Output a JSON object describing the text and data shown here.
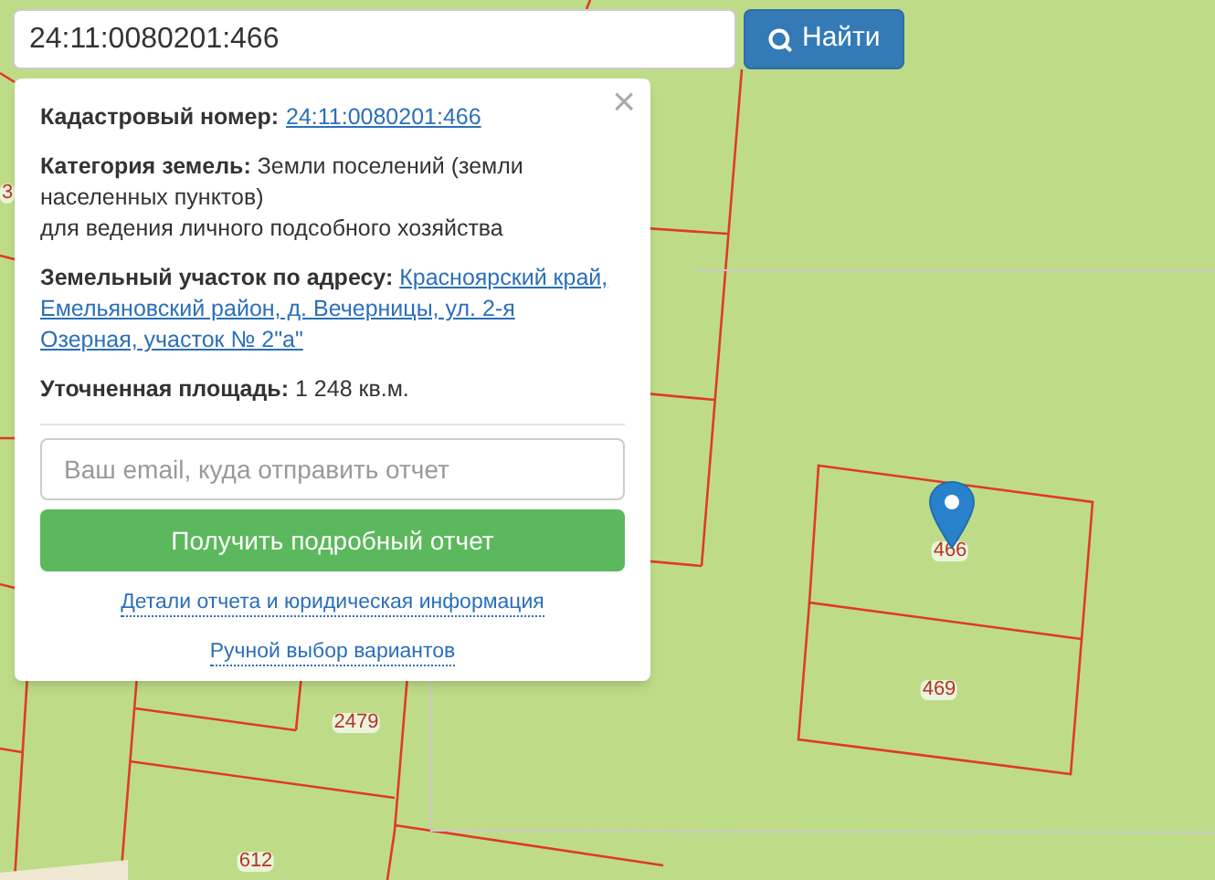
{
  "search": {
    "value": "24:11:0080201:466",
    "button": "Найти"
  },
  "popup": {
    "close": "×",
    "fields": [
      {
        "kind": "link",
        "label": "Кадастровый номер:",
        "value": "24:11:0080201:466"
      },
      {
        "kind": "text",
        "label": "Категория земель:",
        "value": "Земли поселений (земли населенных пунктов)",
        "note": "для ведения личного подсобного хозяйства"
      },
      {
        "kind": "address",
        "label": "Земельный участок по адресу:",
        "value": "Красноярский край, Емельяновский район, д. Вечерницы, ул. 2-я Озерная, участок № 2\"а\""
      },
      {
        "kind": "text",
        "label": "Уточненная площадь:",
        "value": "1 248 кв.м."
      }
    ],
    "email": {
      "placeholder": "Ваш email, куда отправить отчет"
    },
    "submit": "Получить подробный отчет",
    "links": [
      "Детали отчета и юридическая информация",
      "Ручной выбор вариантов"
    ]
  },
  "map": {
    "parcel_labels": [
      "3",
      "466",
      "469",
      "2479",
      "612"
    ]
  }
}
